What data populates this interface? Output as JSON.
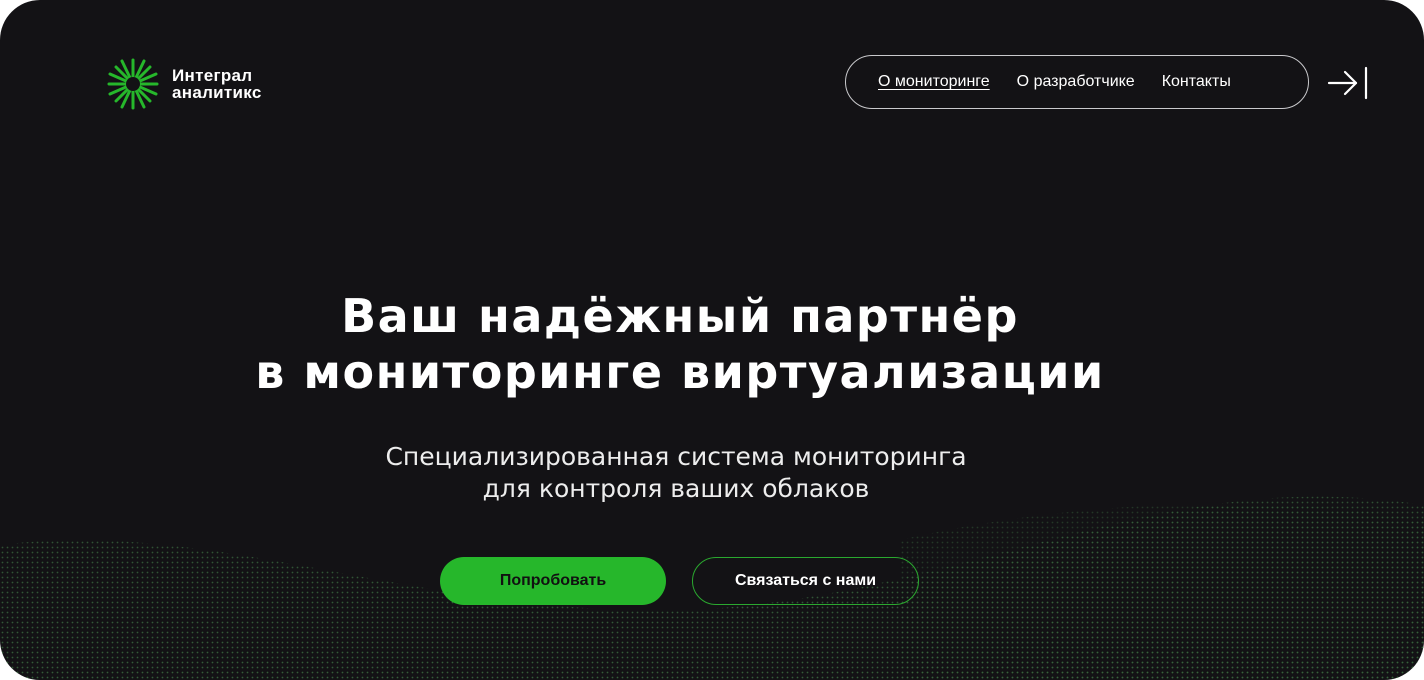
{
  "brand": {
    "name_line1": "Интеграл",
    "name_line2": "аналитикс",
    "logo_icon": "starburst-icon",
    "accent": "#26b72b"
  },
  "nav": {
    "items": [
      {
        "label": "О мониторинге",
        "active": true
      },
      {
        "label": "О разработчике",
        "active": false
      },
      {
        "label": "Контакты",
        "active": false
      }
    ],
    "login_icon": "login-arrow-icon"
  },
  "hero": {
    "title_line1": "Ваш надёжный партнёр",
    "title_line2": "в мониторинге виртуализации",
    "subtitle_line1": "Специализированная система мониторинга",
    "subtitle_line2": "для контроля ваших облаков"
  },
  "actions": {
    "primary_label": "Попробовать",
    "secondary_label": "Связаться с нами"
  },
  "colors": {
    "background": "#131215",
    "accent": "#26b72b",
    "text": "#ffffff"
  }
}
